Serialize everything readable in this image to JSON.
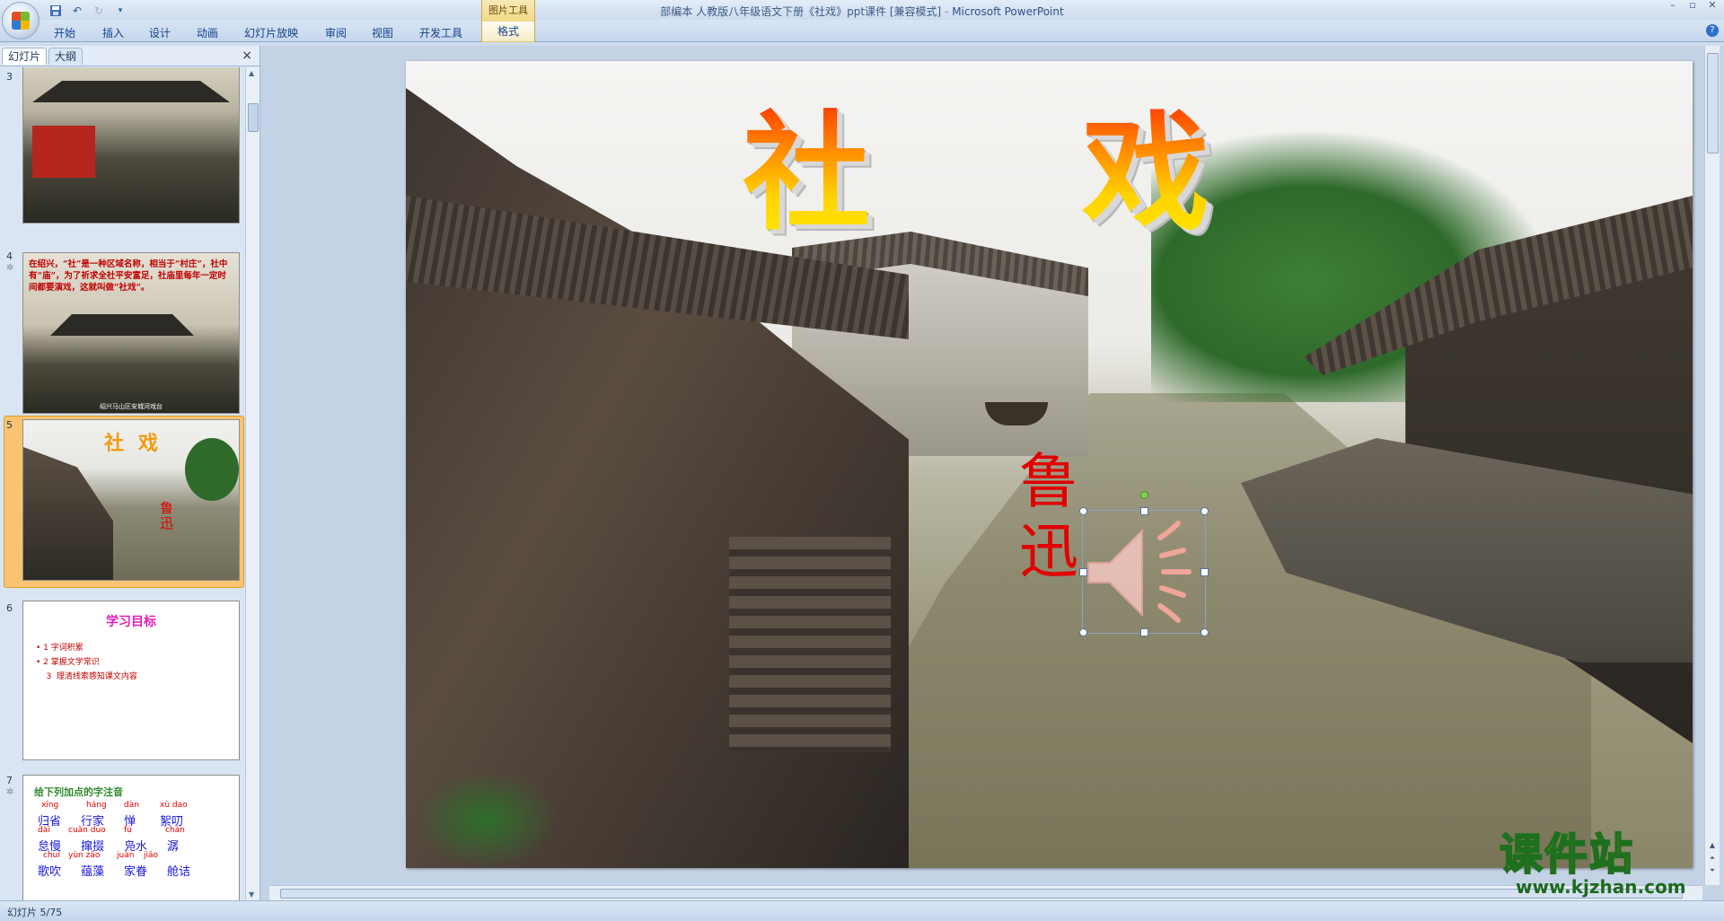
{
  "window": {
    "title": "部编本 人教版八年级语文下册《社戏》ppt课件 [兼容模式]",
    "separator": " - ",
    "app": "Microsoft PowerPoint"
  },
  "ribbon": {
    "tabs": [
      "开始",
      "插入",
      "设计",
      "动画",
      "幻灯片放映",
      "审阅",
      "视图",
      "开发工具"
    ],
    "contextual_group": "图片工具",
    "contextual_tab": "格式"
  },
  "left_panel": {
    "tabs": [
      "幻灯片",
      "大纲"
    ],
    "close": "×",
    "slides": [
      {
        "number": "3"
      },
      {
        "number": "4",
        "text": "在绍兴，“社”是一种区域名称，相当于“村庄”，社中有“庙”，为了祈求全社平安富足，社庙里每年一定时间都要演戏，这就叫做“社戏”。",
        "caption": "绍兴马山区安城河戏台"
      },
      {
        "number": "5",
        "title_chars": [
          "社",
          "戏"
        ],
        "author": "鲁迅",
        "selected": true
      },
      {
        "number": "6",
        "heading": "学习目标",
        "goals": [
          "•  1  字词积累",
          "•  2  掌握文学常识",
          "    3  理清线索感知课文内容"
        ]
      },
      {
        "number": "7",
        "heading": "给下列加点的字注音",
        "rows": [
          {
            "pinyin": [
              "xīng",
              "háng",
              "dàn",
              "xù dao"
            ],
            "words": [
              "归省",
              "行家",
              "惮",
              "絮叨"
            ]
          },
          {
            "pinyin": [
              "dài",
              "cuān duo",
              "fú",
              "chán"
            ],
            "words": [
              "怠慢",
              "撺掇",
              "凫水",
              "潺"
            ]
          },
          {
            "pinyin": [
              "chuí",
              "yùn zǎo",
              "juàn",
              "jiǎo"
            ],
            "words": [
              "歌吹",
              "蕴藻",
              "家眷",
              "舱诘"
            ]
          }
        ]
      }
    ]
  },
  "slide": {
    "title_chars": [
      "社",
      "戏"
    ],
    "author": "鲁迅",
    "speaker_icon": "speaker-icon",
    "accent_title": "#ff8a00",
    "accent_author": "#e00000"
  },
  "watermark": {
    "main": "课件站",
    "url": "www.kjzhan.com"
  },
  "status": {
    "slide_counter": "幻灯片 5/75"
  }
}
